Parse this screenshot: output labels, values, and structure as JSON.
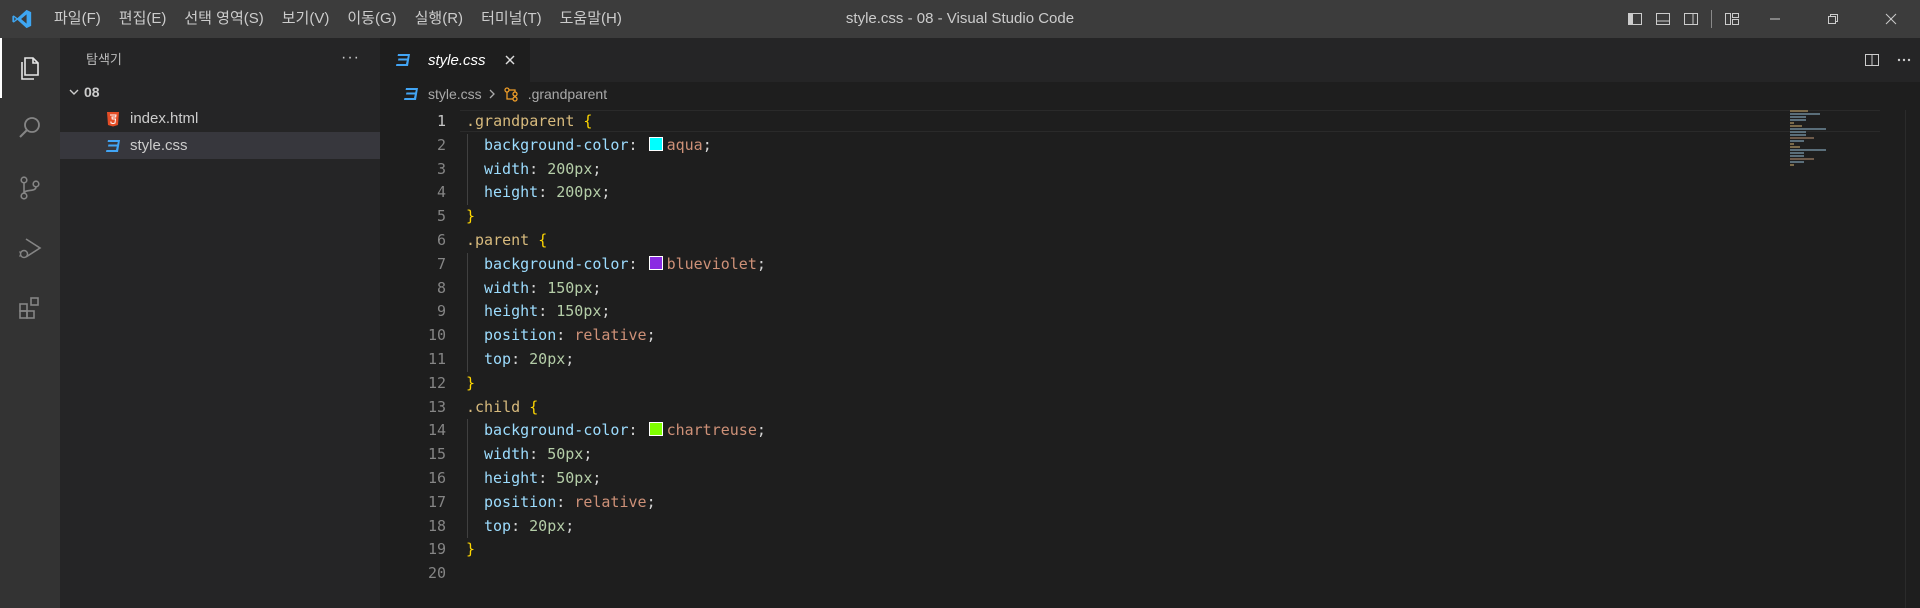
{
  "titlebar": {
    "window_title": "style.css - 08 - Visual Studio Code",
    "menu": [
      "파일(F)",
      "편집(E)",
      "선택 영역(S)",
      "보기(V)",
      "이동(G)",
      "실행(R)",
      "터미널(T)",
      "도움말(H)"
    ],
    "accent": "#007acc"
  },
  "activity_bar": {
    "items": [
      "files-icon",
      "search-icon",
      "source-control-icon",
      "run-debug-icon",
      "extensions-icon"
    ]
  },
  "sidebar": {
    "title": "탐색기",
    "more": "···",
    "folder": "08",
    "files": [
      {
        "name": "index.html",
        "icon": "html5-icon",
        "color": "#e44d26"
      },
      {
        "name": "style.css",
        "icon": "css3-icon",
        "color": "#42a5f5",
        "selected": true
      }
    ]
  },
  "editor": {
    "tab": {
      "label": "style.css"
    },
    "breadcrumb": {
      "file": "style.css",
      "symbol": ".grandparent"
    },
    "line_numbers": [
      "1",
      "2",
      "3",
      "4",
      "5",
      "6",
      "7",
      "8",
      "9",
      "10",
      "11",
      "12",
      "13",
      "14",
      "15",
      "16",
      "17",
      "18",
      "19",
      "20"
    ],
    "code": {
      "l1": {
        "selector": ".grandparent",
        "brace": "{"
      },
      "l2": {
        "prop": "background-color",
        "value": "aqua",
        "swatch": "#00ffff"
      },
      "l3": {
        "prop": "width",
        "value": "200px"
      },
      "l4": {
        "prop": "height",
        "value": "200px"
      },
      "l5": {
        "brace": "}"
      },
      "l6": {
        "selector": ".parent",
        "brace": "{"
      },
      "l7": {
        "prop": "background-color",
        "value": "blueviolet",
        "swatch": "#8a2be2"
      },
      "l8": {
        "prop": "width",
        "value": "150px"
      },
      "l9": {
        "prop": "height",
        "value": "150px"
      },
      "l10": {
        "prop": "position",
        "value": "relative"
      },
      "l11": {
        "prop": "top",
        "value": "20px"
      },
      "l12": {
        "brace": "}"
      },
      "l13": {
        "selector": ".child",
        "brace": "{"
      },
      "l14": {
        "prop": "background-color",
        "value": "chartreuse",
        "swatch": "#7fff00"
      },
      "l15": {
        "prop": "width",
        "value": "50px"
      },
      "l16": {
        "prop": "height",
        "value": "50px"
      },
      "l17": {
        "prop": "position",
        "value": "relative"
      },
      "l18": {
        "prop": "top",
        "value": "20px"
      },
      "l19": {
        "brace": "}"
      }
    },
    "punct": {
      "colon": ": ",
      "semi": ";",
      "space": " "
    }
  }
}
